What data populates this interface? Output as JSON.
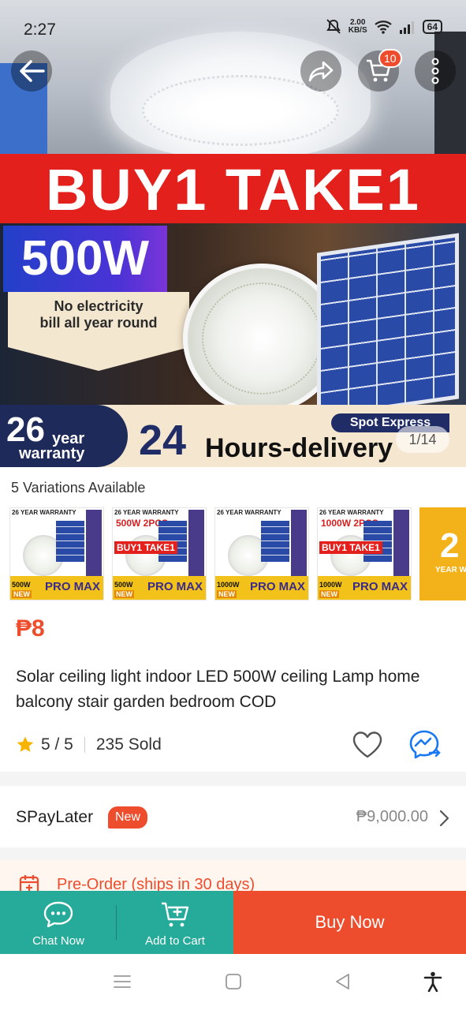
{
  "status_bar": {
    "time": "2:27",
    "net_speed_value": "2.00",
    "net_speed_unit": "KB/S",
    "battery": "64"
  },
  "hero": {
    "banner_text": "BUY1 TAKE1",
    "wattage": "500W",
    "ribbon_line1": "No electricity",
    "ribbon_line2": "bill all year round",
    "warranty_number": "26",
    "warranty_year": "year",
    "warranty_word": "warranty",
    "spot_express": "Spot Express",
    "delivery_number": "24",
    "delivery_text": "Hours-delivery",
    "image_counter": "1/14"
  },
  "top_buttons": {
    "cart_badge": "10"
  },
  "variations": {
    "label": "5 Variations Available",
    "items": [
      {
        "header": "26 YEAR WARRANTY",
        "sub": "",
        "buy": "",
        "watt": "500W",
        "pro": "PRO MAX",
        "new": "NEW"
      },
      {
        "header": "26 YEAR WARRANTY",
        "sub": "500W 2PCS",
        "buy": "BUY1 TAKE1",
        "watt": "500W",
        "pro": "PRO MAX",
        "new": "NEW"
      },
      {
        "header": "26 YEAR WARRANTY",
        "sub": "",
        "buy": "",
        "watt": "1000W",
        "pro": "PRO MAX",
        "new": "NEW"
      },
      {
        "header": "26 YEAR WARRANTY",
        "sub": "1000W 2PCS",
        "buy": "BUY1 TAKE1",
        "watt": "1000W",
        "pro": "PRO MAX",
        "new": "NEW"
      }
    ],
    "more_big": "2",
    "more_small": "YEAR WA"
  },
  "product": {
    "price": "₱8",
    "title": "Solar ceiling light indoor LED 500W ceiling Lamp home balcony stair garden bedroom COD",
    "rating": "5 / 5",
    "sold": "235 Sold"
  },
  "spaylater": {
    "label": "SPayLater",
    "badge": "New",
    "amount": "₱9,000.00"
  },
  "preorder": {
    "text": "Pre-Order (ships in 30 days)"
  },
  "actions": {
    "chat_label": "Chat Now",
    "cart_label": "Add to Cart",
    "buy_label": "Buy Now"
  },
  "colors": {
    "brand": "#ee4d2d",
    "action_teal": "#26aa99",
    "star": "#f6b400"
  }
}
